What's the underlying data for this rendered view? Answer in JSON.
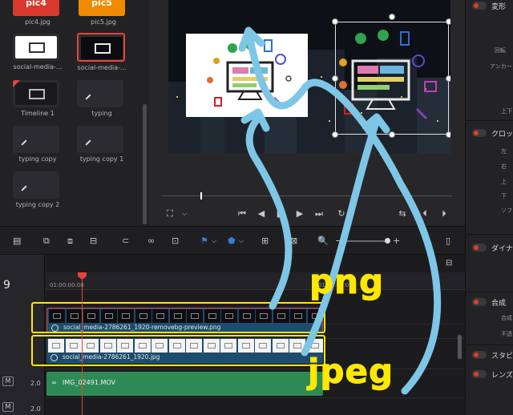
{
  "media_pool": {
    "clips": [
      {
        "label": "pic4.jpg",
        "thumb_text": "pic4",
        "kind": "red"
      },
      {
        "label": "pic5.jpg",
        "thumb_text": "pic5",
        "kind": "orange"
      },
      {
        "label": "social-media-...",
        "kind": "art-light"
      },
      {
        "label": "social-media-...",
        "kind": "art-dark",
        "selected": true
      },
      {
        "label": "Timeline 1",
        "kind": "timeline"
      },
      {
        "label": "typing",
        "kind": "text"
      },
      {
        "label": "typing copy",
        "kind": "text"
      },
      {
        "label": "typing copy 1",
        "kind": "text"
      },
      {
        "label": "typing copy 2",
        "kind": "text"
      }
    ]
  },
  "inspector": {
    "sections": [
      {
        "title": "変形",
        "subs": [
          "回転",
          "アンカー"
        ]
      },
      {
        "title": "クロッ",
        "subs": [
          "左",
          "右",
          "上",
          "下",
          "ソフ"
        ]
      },
      {
        "title": "ダイナ",
        "subs": []
      },
      {
        "title": "合成",
        "subs": [
          "合成",
          "不透"
        ]
      },
      {
        "title": "スタビ",
        "subs": []
      },
      {
        "title": "レンズ",
        "subs": []
      }
    ],
    "extra": "上下"
  },
  "timeline": {
    "timecode": "9",
    "ruler_ticks": [
      "01:00:00:00",
      "01:00:00:00"
    ],
    "tracks": [
      {
        "name": "social_media-2786261_1920-removebg-preview.png",
        "style": "dark"
      },
      {
        "name": "social_media-2786261_1920.jpg",
        "style": "light"
      }
    ],
    "audio": {
      "name": "IMG_02491.MOV",
      "m": "M",
      "volume": "2.0"
    },
    "audio2": {
      "m": "M",
      "volume": "2.0"
    }
  },
  "annotations": {
    "png": "png",
    "jpeg": "jpeg",
    "color": "#ffe800",
    "arrow_color": "#7ec6e6"
  },
  "colors": {
    "accent_red": "#e2453c",
    "clip_blue": "#1e4c6e",
    "audio_green": "#2e8a55"
  }
}
